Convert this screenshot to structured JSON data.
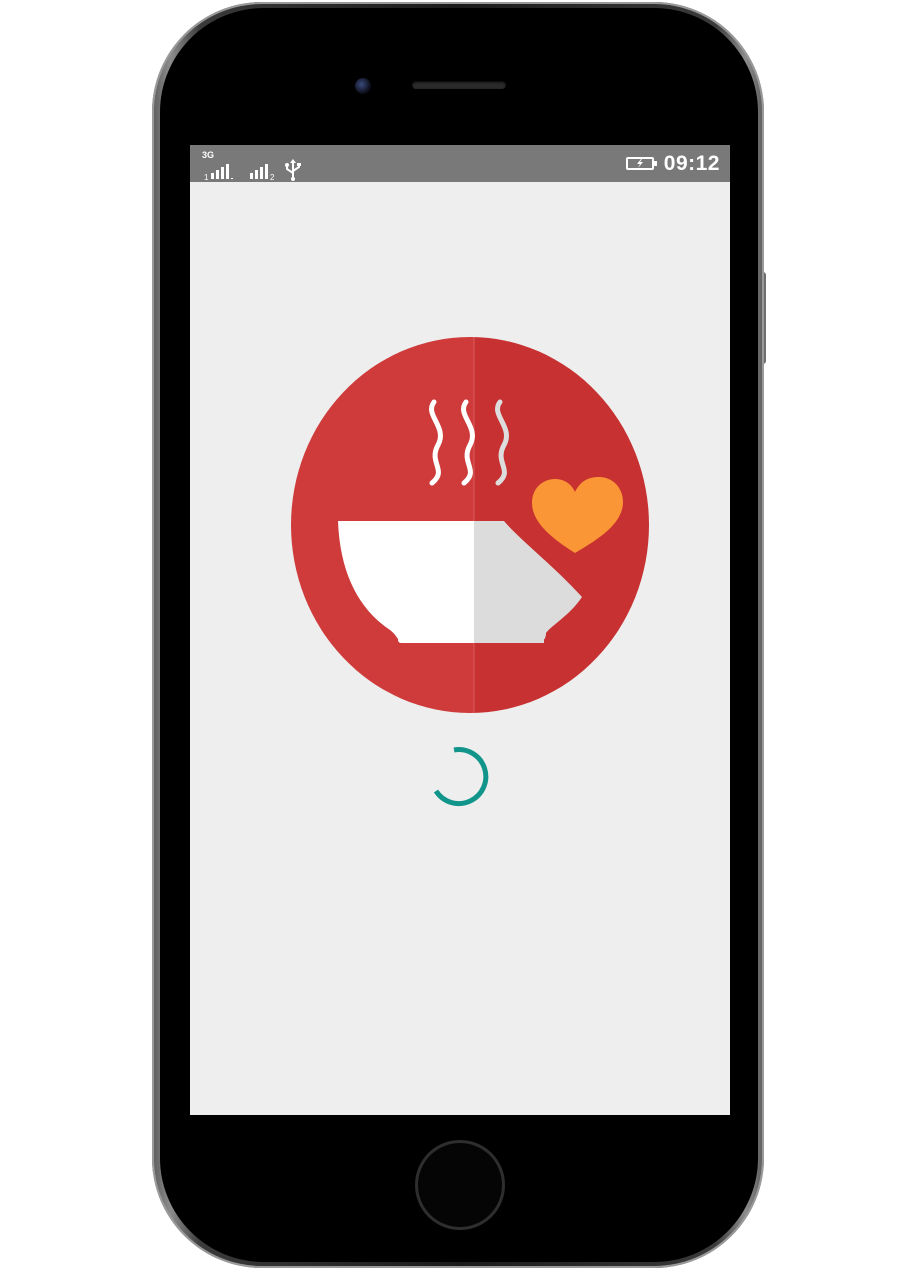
{
  "status_bar": {
    "network_type": "3G",
    "sim1_index": "1",
    "sim2_index": "2",
    "icons": [
      "signal-sim1-icon",
      "signal-sim2-icon",
      "usb-icon",
      "battery-charging-icon"
    ],
    "time": "09:12"
  },
  "splash": {
    "logo_icon": "soup-bowl-heart-logo",
    "loading_indicator": "circular-progress-spinner"
  },
  "colors": {
    "logo_circle_left": "#cf3b3b",
    "logo_circle_right": "#c73131",
    "bowl_white": "#ffffff",
    "bowl_shade": "#dcdcdc",
    "heart": "#fb9636",
    "spinner": "#11958a",
    "screen_background": "#eeeeee",
    "status_bar": "#797979"
  }
}
